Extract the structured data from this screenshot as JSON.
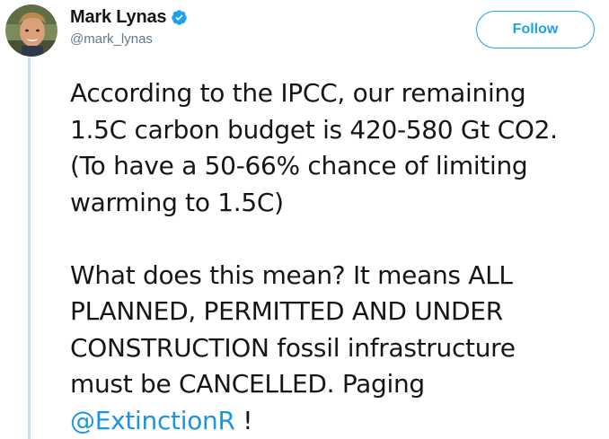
{
  "author": {
    "display_name": "Mark Lynas",
    "handle": "@mark_lynas",
    "verified": true,
    "avatar_icon": "profile-photo"
  },
  "follow_button": {
    "label": "Follow"
  },
  "tweet": {
    "paragraph1": [
      "According to the IPCC, our remaining",
      "1.5C carbon budget is 420-580 Gt CO2.",
      "(To have a 50-66% chance of limiting",
      "warming to 1.5C)"
    ],
    "paragraph2": [
      "What does this mean? It means ALL",
      "PLANNED, PERMITTED AND UNDER",
      "CONSTRUCTION fossil infrastructure",
      "must be CANCELLED. Paging"
    ],
    "mention": "@ExtinctionR",
    "after_mention": " !"
  },
  "colors": {
    "accent": "#1da1f2",
    "mention": "#1b95e0",
    "thread_line": "#c4e2f7",
    "handle": "#657786"
  }
}
